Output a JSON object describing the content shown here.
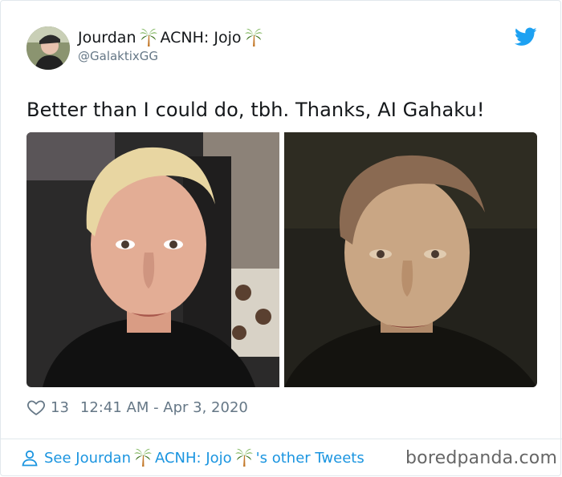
{
  "tweet": {
    "author_name": "Jourdan",
    "author_name_suffix": "ACNH: Jojo",
    "handle": "@GalaktixGG",
    "text": "Better than I could do, tbh. Thanks, AI Gahaku!",
    "like_count": "13",
    "timestamp": "12:41 AM - Apr 3, 2020"
  },
  "footer": {
    "see_prefix": "See Jourdan",
    "see_name": "ACNH: Jojo",
    "see_suffix": "'s other Tweets",
    "watermark": "boredpanda.com"
  },
  "icons": {
    "brand": "twitter-bird-icon",
    "like": "heart-icon",
    "profile": "person-icon",
    "emoji": "palm-tree-icon"
  },
  "colors": {
    "link": "#1b95e0",
    "muted": "#657786",
    "twitter_blue": "#1da1f2"
  }
}
